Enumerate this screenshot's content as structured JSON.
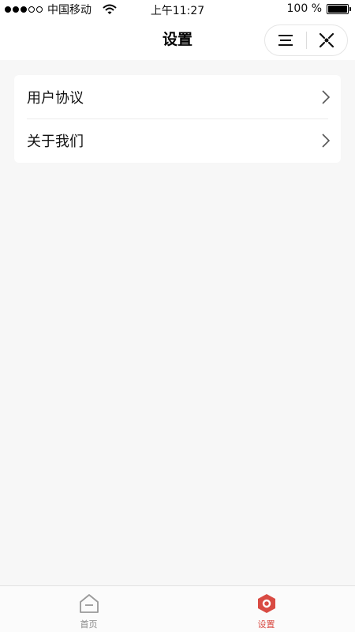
{
  "status_bar": {
    "carrier": "中国移动",
    "time": "上午11:27",
    "battery": "100 %"
  },
  "nav": {
    "title": "设置",
    "menu_icon": "menu-icon",
    "close_icon": "close-capsule-icon"
  },
  "settings_list": {
    "items": [
      {
        "label": "用户协议",
        "icon": "chevron-right-icon"
      },
      {
        "label": "关于我们",
        "icon": "chevron-right-icon"
      }
    ]
  },
  "tab_bar": {
    "tabs": [
      {
        "label": "首页",
        "icon": "home-icon",
        "active": false
      },
      {
        "label": "设置",
        "icon": "settings-icon",
        "active": true
      }
    ]
  },
  "colors": {
    "accent": "#d94b43",
    "background": "#f7f7f7",
    "inactive": "#888888"
  }
}
